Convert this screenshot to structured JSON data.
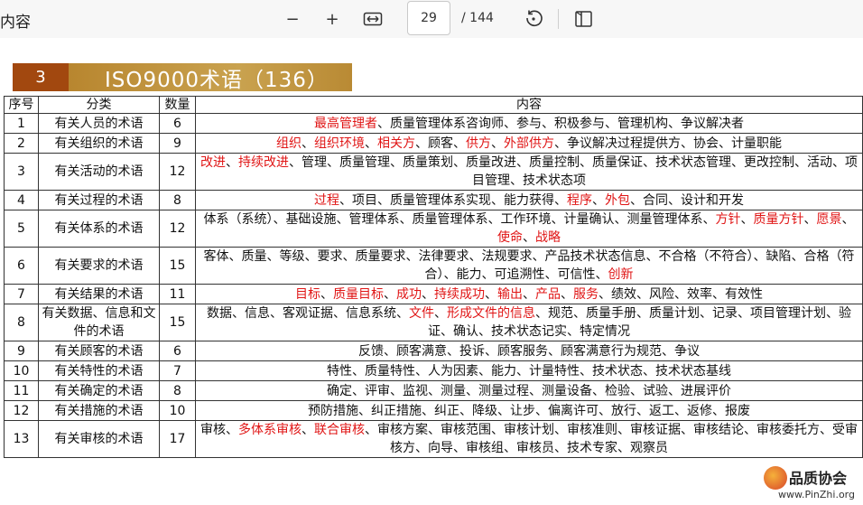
{
  "toolbar": {
    "doc_title": "内容",
    "zoom_out": "−",
    "zoom_in": "+",
    "page_current": "29",
    "page_total": "/ 144"
  },
  "banner": {
    "number": "3",
    "title": "ISO9000术语（136）"
  },
  "table": {
    "headers": [
      "序号",
      "分类",
      "数量",
      "内容"
    ],
    "rows": [
      {
        "no": "1",
        "cat": "有关人员的术语",
        "count": "6",
        "segs": [
          {
            "t": "最高管理者",
            "r": true
          },
          {
            "t": "、质量管理体系咨询师、参与、积极参与、管理机构、争议解决者",
            "r": false
          }
        ]
      },
      {
        "no": "2",
        "cat": "有关组织的术语",
        "count": "9",
        "segs": [
          {
            "t": "组织",
            "r": true
          },
          {
            "t": "、",
            "r": false
          },
          {
            "t": "组织环境",
            "r": true
          },
          {
            "t": "、",
            "r": false
          },
          {
            "t": "相关方",
            "r": true
          },
          {
            "t": "、顾客、",
            "r": false
          },
          {
            "t": "供方",
            "r": true
          },
          {
            "t": "、",
            "r": false
          },
          {
            "t": "外部供方",
            "r": true
          },
          {
            "t": "、争议解决过程提供方、协会、计量职能",
            "r": false
          }
        ]
      },
      {
        "no": "3",
        "cat": "有关活动的术语",
        "count": "12",
        "segs": [
          {
            "t": "改进",
            "r": true
          },
          {
            "t": "、",
            "r": false
          },
          {
            "t": "持续改进",
            "r": true
          },
          {
            "t": "、管理、质量管理、质量策划、质量改进、质量控制、质量保证、技术状态管理、更改控制、活动、项目管理、技术状态项",
            "r": false
          }
        ]
      },
      {
        "no": "4",
        "cat": "有关过程的术语",
        "count": "8",
        "segs": [
          {
            "t": "过程",
            "r": true
          },
          {
            "t": "、项目、质量管理体系实现、能力获得、",
            "r": false
          },
          {
            "t": "程序",
            "r": true
          },
          {
            "t": "、",
            "r": false
          },
          {
            "t": "外包",
            "r": true
          },
          {
            "t": "、合同、设计和开发",
            "r": false
          }
        ]
      },
      {
        "no": "5",
        "cat": "有关体系的术语",
        "count": "12",
        "segs": [
          {
            "t": "体系（系统）、基础设施、管理体系、质量管理体系、工作环境、计量确认、测量管理体系、",
            "r": false
          },
          {
            "t": "方针",
            "r": true
          },
          {
            "t": "、",
            "r": false
          },
          {
            "t": "质量方针",
            "r": true
          },
          {
            "t": "、",
            "r": false
          },
          {
            "t": "愿景",
            "r": true
          },
          {
            "t": "、",
            "r": false
          },
          {
            "t": "使命",
            "r": true
          },
          {
            "t": "、",
            "r": false
          },
          {
            "t": "战略",
            "r": true
          }
        ]
      },
      {
        "no": "6",
        "cat": "有关要求的术语",
        "count": "15",
        "segs": [
          {
            "t": "客体、质量、等级、要求、质量要求、法律要求、法规要求、产品技术状态信息、不合格（不符合）、缺陷、合格（符合）、能力、可追溯性、可信性、",
            "r": false
          },
          {
            "t": "创新",
            "r": true
          }
        ]
      },
      {
        "no": "7",
        "cat": "有关结果的术语",
        "count": "11",
        "segs": [
          {
            "t": "目标",
            "r": true
          },
          {
            "t": "、",
            "r": false
          },
          {
            "t": "质量目标",
            "r": true
          },
          {
            "t": "、",
            "r": false
          },
          {
            "t": "成功",
            "r": true
          },
          {
            "t": "、",
            "r": false
          },
          {
            "t": "持续成功",
            "r": true
          },
          {
            "t": "、",
            "r": false
          },
          {
            "t": "输出",
            "r": true
          },
          {
            "t": "、",
            "r": false
          },
          {
            "t": "产品",
            "r": true
          },
          {
            "t": "、",
            "r": false
          },
          {
            "t": "服务",
            "r": true
          },
          {
            "t": "、绩效、风险、效率、有效性",
            "r": false
          }
        ]
      },
      {
        "no": "8",
        "cat": "有关数据、信息和文件的术语",
        "count": "15",
        "segs": [
          {
            "t": "数据、信息、客观证据、信息系统、",
            "r": false
          },
          {
            "t": "文件",
            "r": true
          },
          {
            "t": "、",
            "r": false
          },
          {
            "t": "形成文件的信息",
            "r": true
          },
          {
            "t": "、规范、质量手册、质量计划、记录、项目管理计划、验证、确认、技术状态记实、特定情况",
            "r": false
          }
        ]
      },
      {
        "no": "9",
        "cat": "有关顾客的术语",
        "count": "6",
        "segs": [
          {
            "t": "反馈、顾客满意、投诉、顾客服务、顾客满意行为规范、争议",
            "r": false
          }
        ]
      },
      {
        "no": "10",
        "cat": "有关特性的术语",
        "count": "7",
        "segs": [
          {
            "t": "特性、质量特性、人为因素、能力、计量特性、技术状态、技术状态基线",
            "r": false
          }
        ]
      },
      {
        "no": "11",
        "cat": "有关确定的术语",
        "count": "8",
        "segs": [
          {
            "t": "确定、评审、监视、测量、测量过程、测量设备、检验、试验、进展评价",
            "r": false
          }
        ]
      },
      {
        "no": "12",
        "cat": "有关措施的术语",
        "count": "10",
        "segs": [
          {
            "t": "预防措施、纠正措施、纠正、降级、让步、偏离许可、放行、返工、返修、报废",
            "r": false
          }
        ]
      },
      {
        "no": "13",
        "cat": "有关审核的术语",
        "count": "17",
        "segs": [
          {
            "t": "审核、",
            "r": false
          },
          {
            "t": "多体系审核",
            "r": true
          },
          {
            "t": "、",
            "r": false
          },
          {
            "t": "联合审核",
            "r": true
          },
          {
            "t": "、审核方案、审核范围、审核计划、审核准则、审核证据、审核结论、审核委托方、受审核方、向导、审核组、审核员、技术专家、观察员",
            "r": false
          }
        ]
      }
    ]
  },
  "watermark": {
    "name": "品质协会",
    "url": "www.PinZhi.org"
  }
}
